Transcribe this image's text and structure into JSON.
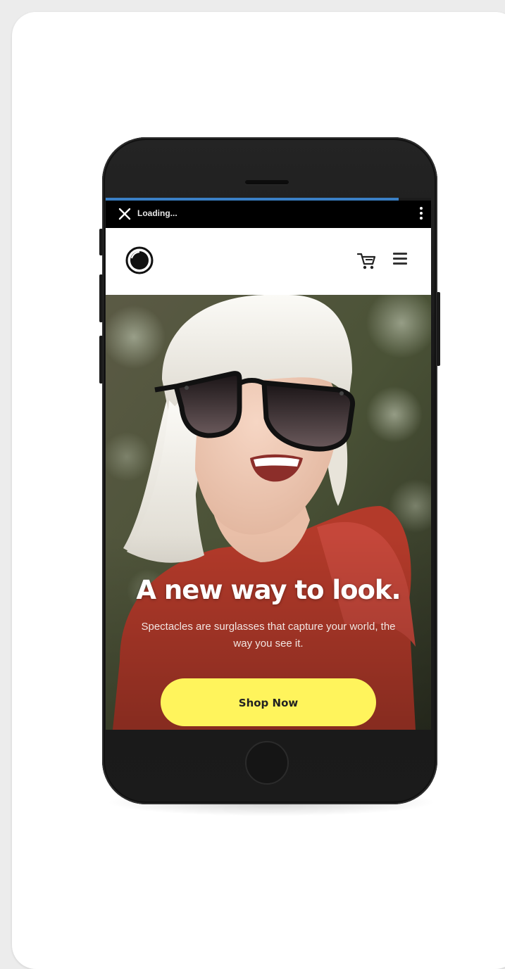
{
  "browser": {
    "status_text": "Loading...",
    "progress": 0.9
  },
  "site": {
    "logo_icon": "spectacles-logo-icon",
    "cart_icon": "cart-icon",
    "menu_icon": "hamburger-menu-icon"
  },
  "hero": {
    "title": "A new way to look.",
    "subtitle": "Spectacles are surglasses that capture your world, the way you see it.",
    "cta_label": "Shop Now"
  },
  "colors": {
    "cta": "#fff45c",
    "progress": "#3a7fc4",
    "shirt": "#b33a2a"
  }
}
